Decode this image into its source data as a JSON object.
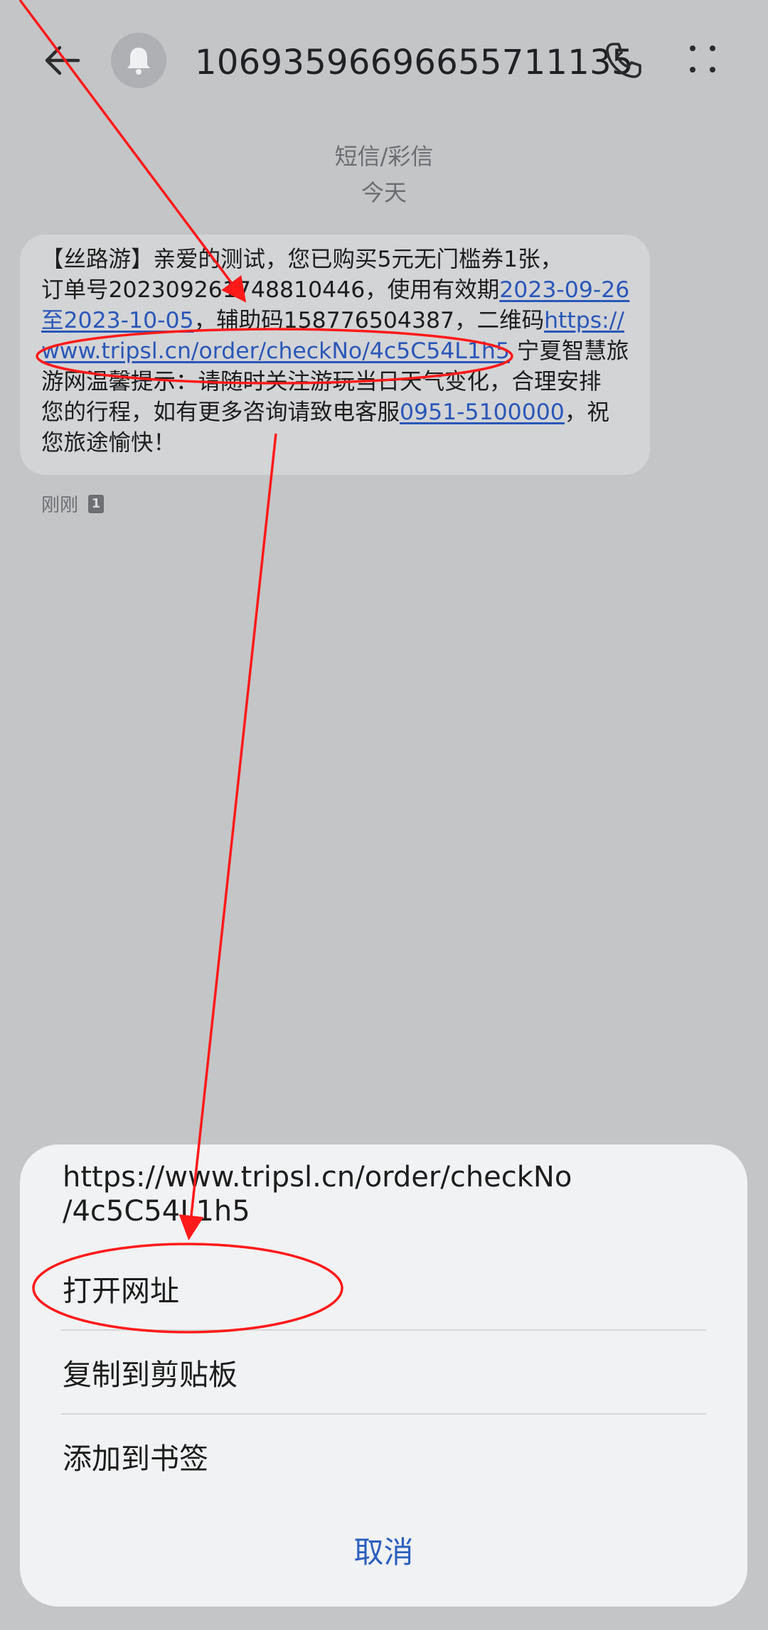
{
  "header": {
    "back_icon": "back-arrow-icon",
    "avatar_icon": "bell-icon",
    "sender_number": "106935966966557111​35",
    "call_icon": "phone-icon",
    "menu_icon": "more-vert-icon"
  },
  "thread": {
    "message_type": "短信/彩信",
    "date_label": "今天"
  },
  "message": {
    "l1": "【丝路游】亲爱的测试，您已购买5元无门槛券1张，",
    "l2_text": "订单号20230926174881044​6，使用有效期",
    "l2_link": "2023-09-26",
    "l3_link": "至2023-10-05",
    "l3_text": "，辅助码158776504387，二维码",
    "l3_link2": "https://",
    "l4_link": "www.tripsl.cn/order/checkNo/4c5C54L1h5",
    "l4_text": " 宁夏智慧旅",
    "l5": "游网温馨提示：请随时关注游玩当日天气变化，合理安排",
    "l6_text": "您的行程，如有更多咨询请致电客服",
    "l6_link": "0951-5100000",
    "l6_text2": "，祝",
    "l7": "您旅途愉快！",
    "time": "刚刚",
    "sim": "1"
  },
  "sheet": {
    "url_line1": "https://www.tripsl.cn/order/checkNo",
    "url_line2": "/4c5C54L1h5",
    "open_url": "打开网址",
    "copy": "复制到剪贴板",
    "bookmark": "添加到书签",
    "cancel": "取消"
  },
  "colors": {
    "link": "#2a57b8",
    "annotation": "#ff1a1a",
    "cancel": "#2a5fbd"
  }
}
